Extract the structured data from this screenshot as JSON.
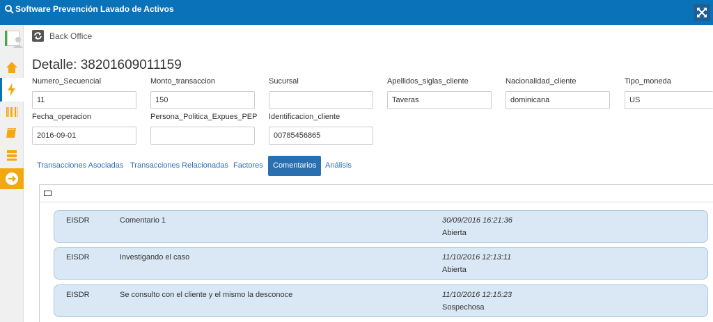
{
  "app": {
    "title": "Software Prevención Lavado de Activos"
  },
  "breadcrumb": {
    "label": "Back Office"
  },
  "page": {
    "title": "Detalle: 38201609011159"
  },
  "fields": [
    {
      "label": "Numero_Secuencial",
      "value": "11"
    },
    {
      "label": "Monto_transaccion",
      "value": "150"
    },
    {
      "label": "Sucursal",
      "value": ""
    },
    {
      "label": "Apellidos_siglas_cliente",
      "value": "Taveras"
    },
    {
      "label": "Nacionalidad_cliente",
      "value": "dominicana"
    },
    {
      "label": "Tipo_moneda",
      "value": "US"
    },
    {
      "label": "Fecha_operacion",
      "value": "2016-09-01"
    },
    {
      "label": "Persona_Politica_Expues_PEP",
      "value": ""
    },
    {
      "label": "Identificacion_cliente",
      "value": "00785456865"
    }
  ],
  "tabs": [
    {
      "label": "Transacciones Asociadas"
    },
    {
      "label": "Transacciones Relacionadas"
    },
    {
      "label": "Factores"
    },
    {
      "label": "Comentarios",
      "active": true
    },
    {
      "label": "Análisis"
    }
  ],
  "comments": [
    {
      "user": "EISDR",
      "text": "Comentario 1",
      "date": "30/09/2016 16:21:36",
      "status": "Abierta"
    },
    {
      "user": "EISDR",
      "text": "Investigando el caso",
      "date": "11/10/2016 12:13:11",
      "status": "Abierta"
    },
    {
      "user": "EISDR",
      "text": "Se consulto con el cliente y el mismo la desconoce",
      "date": "11/10/2016 12:15:23",
      "status": "Sospechosa"
    }
  ],
  "colors": {
    "header": "#0a72b8",
    "accent": "#f3a712",
    "comment_bg": "#d9e8f4",
    "tab_active": "#2a6fb0"
  },
  "icons": {
    "app": "magnifier-icon",
    "expand": "fullscreen-icon",
    "user": "user-avatar-icon",
    "home": "home-icon",
    "activity": "lightning-icon",
    "barcode": "barcode-icon",
    "book": "book-icon",
    "list": "list-icon",
    "arrow": "arrow-right-icon",
    "refresh": "refresh-icon",
    "panel": "panel-icon"
  }
}
